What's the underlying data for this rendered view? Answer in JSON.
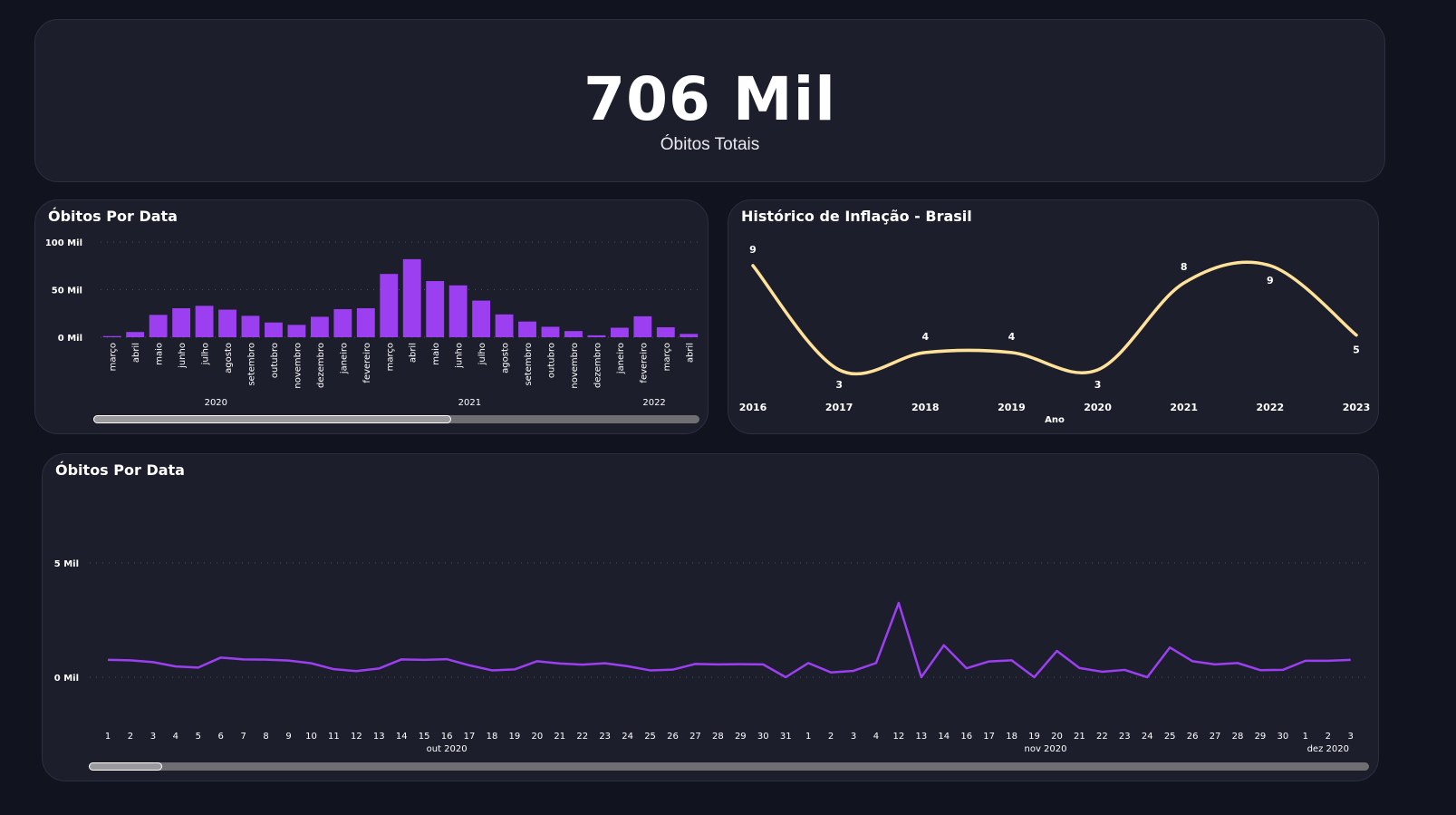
{
  "kpi": {
    "value": "706 Mil",
    "label": "Óbitos Totais"
  },
  "bar_card": {
    "title": "Óbitos Por Data"
  },
  "inflation_card": {
    "title": "Histórico de Inflação - Brasil"
  },
  "line_card": {
    "title": "Óbitos Por Data"
  },
  "colors": {
    "background": "#11131e",
    "card": "#1c1e2c",
    "bar": "#9b3ff1",
    "inflation_line": "#ffe29a",
    "deaths_line": "#9b3ff1",
    "scrollbar": "#6f6f73"
  },
  "chart_data": [
    {
      "type": "bar",
      "title": "Óbitos Por Data",
      "y_ticks": [
        "100 Mil",
        "50 Mil",
        "0 Mil"
      ],
      "ylim": [
        0,
        100000
      ],
      "grid": true,
      "categories": [
        "março",
        "abril",
        "maio",
        "junho",
        "julho",
        "agosto",
        "setembro",
        "outubro",
        "novembro",
        "dezembro",
        "janeiro",
        "fevereiro",
        "março",
        "abril",
        "maio",
        "junho",
        "julho",
        "agosto",
        "setembro",
        "outubro",
        "novembro",
        "dezembro",
        "janeiro",
        "fevereiro",
        "março",
        "abril"
      ],
      "values": [
        1200,
        5500,
        23500,
        30500,
        33000,
        29000,
        22500,
        15500,
        13000,
        21500,
        29500,
        30500,
        66500,
        82000,
        59000,
        54500,
        38500,
        24000,
        16500,
        11000,
        6500,
        2000,
        10000,
        22000,
        10500,
        3500
      ],
      "year_groups": [
        {
          "label": "2020",
          "first": 0,
          "last": 9
        },
        {
          "label": "2021",
          "first": 10,
          "last": 21
        },
        {
          "label": "2022",
          "first": 22,
          "last": 25
        }
      ],
      "scroll": {
        "start": 0,
        "end": 0.59
      }
    },
    {
      "type": "line",
      "title": "Histórico de Inflação - Brasil",
      "xlabel": "Ano",
      "x": [
        "2016",
        "2017",
        "2018",
        "2019",
        "2020",
        "2021",
        "2022",
        "2023"
      ],
      "values": [
        9,
        3,
        4,
        4,
        3,
        8,
        9,
        5
      ],
      "data_labels": [
        "9",
        "3",
        "4",
        "4",
        "3",
        "8",
        "9",
        "5"
      ],
      "smooth": true
    },
    {
      "type": "line",
      "title": "Óbitos Por Data",
      "y_ticks": [
        "5 Mil",
        "0 Mil"
      ],
      "ylim": [
        0,
        5000
      ],
      "grid": true,
      "x": [
        "1",
        "2",
        "3",
        "4",
        "5",
        "6",
        "7",
        "8",
        "9",
        "10",
        "11",
        "12",
        "13",
        "14",
        "15",
        "16",
        "17",
        "18",
        "19",
        "20",
        "21",
        "22",
        "23",
        "24",
        "25",
        "26",
        "27",
        "28",
        "29",
        "30",
        "31",
        "1",
        "2",
        "3",
        "4",
        "12",
        "13",
        "14",
        "16",
        "17",
        "18",
        "19",
        "20",
        "21",
        "22",
        "23",
        "24",
        "25",
        "26",
        "27",
        "28",
        "29",
        "30",
        "1",
        "2",
        "3"
      ],
      "values": [
        760,
        740,
        660,
        470,
        420,
        860,
        780,
        770,
        730,
        610,
        350,
        270,
        380,
        780,
        760,
        790,
        520,
        300,
        340,
        700,
        600,
        550,
        610,
        480,
        300,
        330,
        580,
        560,
        570,
        560,
        0,
        620,
        210,
        280,
        620,
        3250,
        0,
        1400,
        390,
        690,
        740,
        0,
        1150,
        400,
        240,
        320,
        0,
        1300,
        700,
        560,
        620,
        310,
        320,
        720,
        720,
        760
      ],
      "month_groups": [
        {
          "label": "out 2020",
          "first": 0,
          "last": 30
        },
        {
          "label": "nov 2020",
          "first": 31,
          "last": 52
        },
        {
          "label": "dez 2020",
          "first": 53,
          "last": 55
        }
      ],
      "scroll": {
        "start": 0,
        "end": 0.057
      }
    }
  ]
}
